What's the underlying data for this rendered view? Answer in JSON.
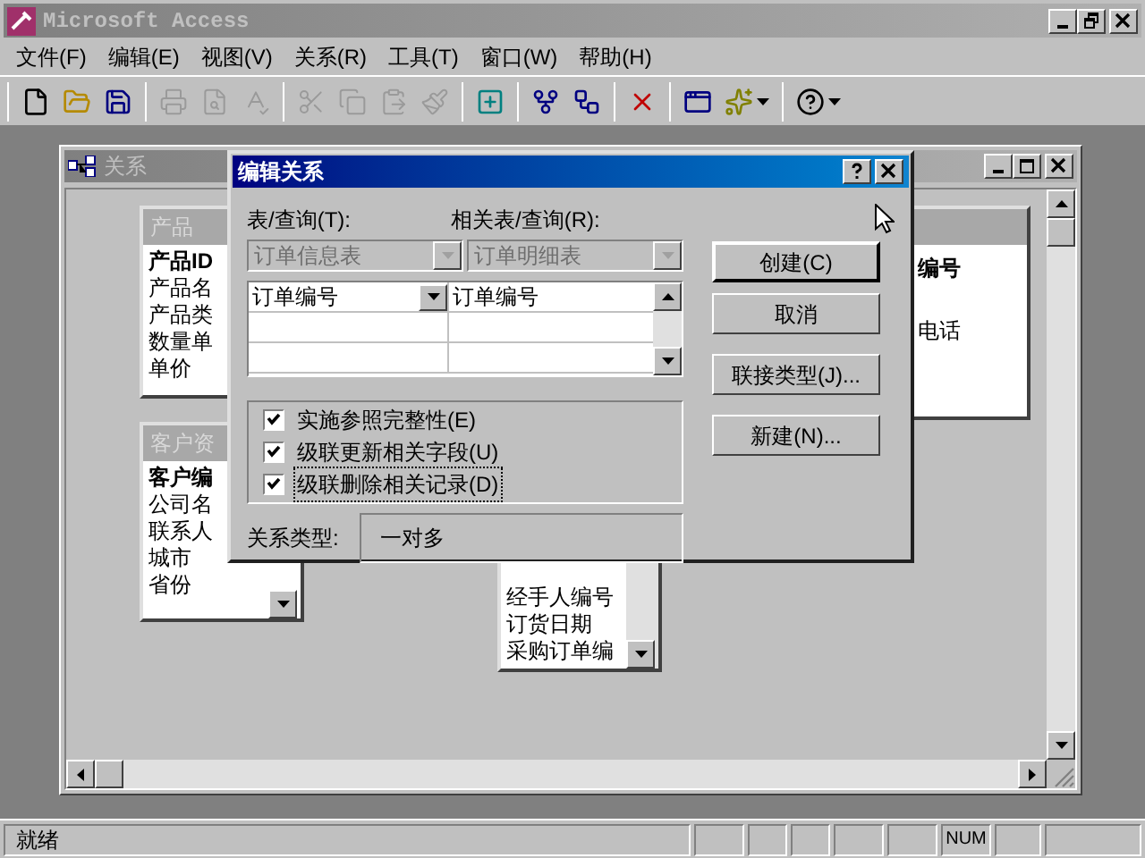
{
  "app_window": {
    "title": "Microsoft Access",
    "active": false
  },
  "menu": [
    "文件(F)",
    "编辑(E)",
    "视图(V)",
    "关系(R)",
    "工具(T)",
    "窗口(W)",
    "帮助(H)"
  ],
  "toolbar": [
    [
      {
        "kind": "button",
        "disabled": false
      },
      {
        "kind": "button",
        "disabled": false
      },
      {
        "kind": "button",
        "disabled": false
      }
    ],
    [
      {
        "kind": "button",
        "disabled": true
      },
      {
        "kind": "button",
        "disabled": true
      },
      {
        "kind": "button",
        "disabled": true
      }
    ],
    [
      {
        "kind": "button",
        "disabled": true
      },
      {
        "kind": "button",
        "disabled": true
      },
      {
        "kind": "button",
        "disabled": true
      },
      {
        "kind": "button",
        "disabled": true
      }
    ],
    [
      {
        "kind": "button",
        "disabled": false
      }
    ],
    [
      {
        "kind": "button",
        "disabled": false
      },
      {
        "kind": "button",
        "disabled": false
      }
    ],
    [
      {
        "kind": "button",
        "disabled": false
      }
    ],
    [
      {
        "kind": "button",
        "disabled": false
      },
      {
        "kind": "dropdown",
        "disabled": false
      }
    ],
    [
      {
        "kind": "dropdown",
        "disabled": false
      }
    ]
  ],
  "relationships_window": {
    "title": "关系",
    "active": false,
    "field_lists": [
      {
        "title": "产品",
        "fields": [
          {
            "name": "产品ID",
            "primary_key": true
          },
          {
            "name": "产品名",
            "primary_key": false
          },
          {
            "name": "产品类",
            "primary_key": false
          },
          {
            "name": "数量单",
            "primary_key": false
          },
          {
            "name": "单价",
            "primary_key": false
          }
        ]
      },
      {
        "title": "客户资",
        "fields": [
          {
            "name": "客户编",
            "primary_key": true
          },
          {
            "name": "公司名",
            "primary_key": false
          },
          {
            "name": "联系人",
            "primary_key": false
          },
          {
            "name": "城市",
            "primary_key": false
          },
          {
            "name": "省份",
            "primary_key": false
          }
        ]
      },
      {
        "fields": [
          {
            "name": "经手人编号",
            "primary_key": false
          },
          {
            "name": "订货日期",
            "primary_key": false
          },
          {
            "name": "采购订单编",
            "primary_key": false
          }
        ]
      },
      {
        "fields": [
          {
            "name": "编号",
            "primary_key": true
          },
          {
            "name": "电话",
            "primary_key": false
          }
        ]
      }
    ]
  },
  "dialog": {
    "title": "编辑关系",
    "table_label": "表/查询(T):",
    "related_label": "相关表/查询(R):",
    "table": {
      "value": "订单信息表",
      "disabled": true
    },
    "related_table": {
      "value": "订单明细表",
      "disabled": true
    },
    "join_rows": [
      {
        "field": "订单编号",
        "related_field": "订单编号"
      }
    ],
    "options": [
      {
        "label": "实施参照完整性(E)",
        "checked": true,
        "focused": false
      },
      {
        "label": "级联更新相关字段(U)",
        "checked": true,
        "focused": false
      },
      {
        "label": "级联删除相关记录(D)",
        "checked": true,
        "focused": true
      }
    ],
    "relationship_type_label": "关系类型:",
    "relationship_type": "一对多",
    "buttons": [
      {
        "label": "创建(C)",
        "default": true
      },
      {
        "label": "取消",
        "default": false
      },
      {
        "label": "联接类型(J)...",
        "default": false
      },
      {
        "label": "新建(N)...",
        "default": false
      }
    ]
  },
  "status_bar": {
    "text": "就绪",
    "indicators": [
      "NUM"
    ]
  }
}
